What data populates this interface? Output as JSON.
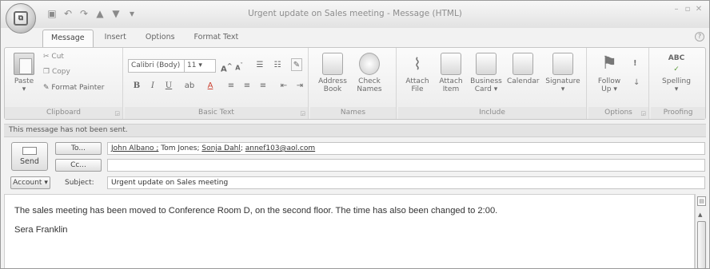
{
  "window": {
    "title": "Urgent update on Sales meeting - Message (HTML)",
    "controls": [
      "–",
      "▫",
      "✕"
    ]
  },
  "quick_access": {
    "icons": [
      "save-icon",
      "undo-icon",
      "redo-icon",
      "previous-icon",
      "next-icon",
      "customize-icon"
    ]
  },
  "tabs": [
    {
      "label": "Message",
      "active": true
    },
    {
      "label": "Insert",
      "active": false
    },
    {
      "label": "Options",
      "active": false
    },
    {
      "label": "Format Text",
      "active": false
    }
  ],
  "ribbon": {
    "clipboard": {
      "label": "Clipboard",
      "paste": "Paste",
      "cut": "Cut",
      "copy": "Copy",
      "format_painter": "Format Painter"
    },
    "basic_text": {
      "label": "Basic Text",
      "font_name": "Calibri (Body)",
      "font_size": "11",
      "bold": "B",
      "italic": "I",
      "underline": "U"
    },
    "names": {
      "label": "Names",
      "address_book": [
        "Address",
        "Book"
      ],
      "check_names": [
        "Check",
        "Names"
      ]
    },
    "include": {
      "label": "Include",
      "attach_file": [
        "Attach",
        "File"
      ],
      "attach_item": [
        "Attach",
        "Item"
      ],
      "business_card": [
        "Business",
        "Card"
      ],
      "calendar": "Calendar",
      "signature": "Signature"
    },
    "options": {
      "label": "Options",
      "follow_up": [
        "Follow",
        "Up"
      ],
      "importance": "!"
    },
    "proofing": {
      "label": "Proofing",
      "spelling": "Spelling",
      "abc": "ABC"
    }
  },
  "infobar": {
    "text": "This message has not been sent."
  },
  "compose": {
    "send_label": "Send",
    "to_label": "To...",
    "cc_label": "Cc...",
    "account_label": "Account",
    "subject_label": "Subject:",
    "to_recipients": [
      {
        "name": "John Albano ;",
        "underlined": true
      },
      {
        "name": " Tom Jones; ",
        "underlined": false
      },
      {
        "name": "Sonja Dahl",
        "underlined": true
      },
      {
        "name": "; ",
        "underlined": false
      },
      {
        "name": "annef103@aol.com",
        "underlined": true
      }
    ],
    "cc_value": "",
    "subject_value": "Urgent update on Sales meeting"
  },
  "body": {
    "paragraphs": [
      "The sales meeting has been moved to Conference Room D, on the second floor. The time has also been changed to 2:00.",
      "Sera Franklin"
    ]
  }
}
